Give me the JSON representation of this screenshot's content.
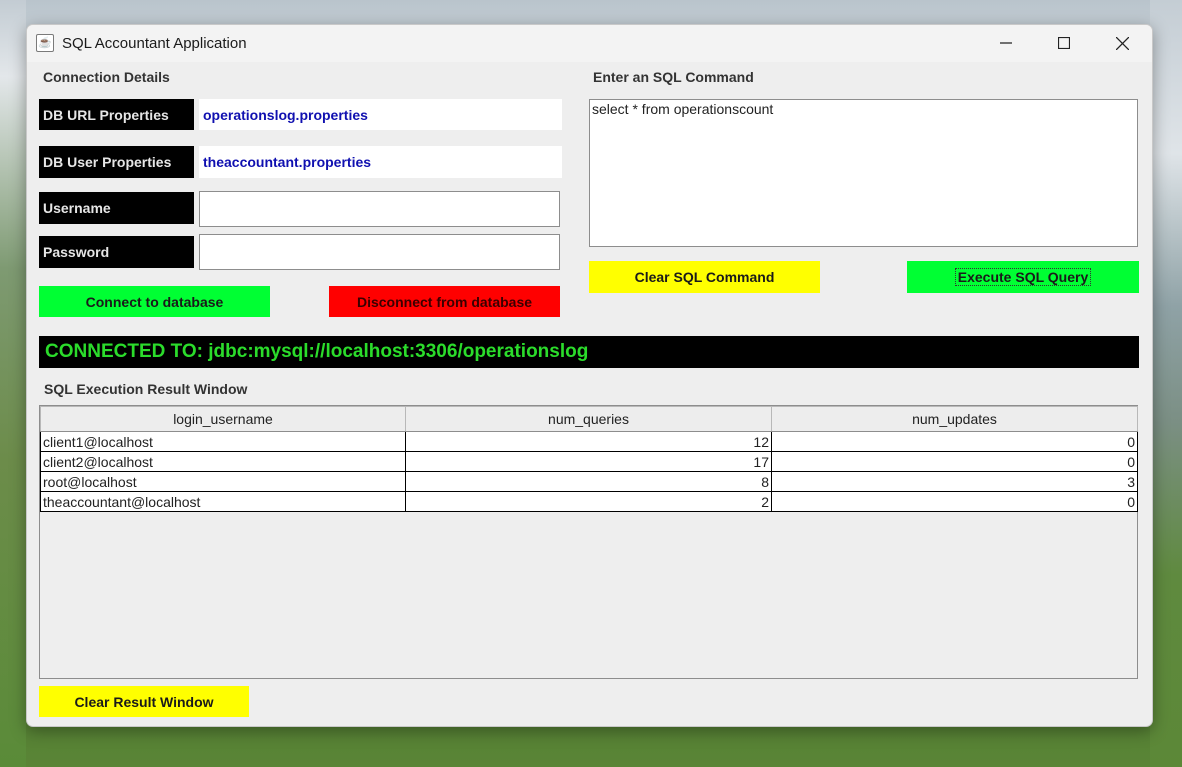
{
  "window": {
    "title": "SQL Accountant Application"
  },
  "connection": {
    "section_label": "Connection Details",
    "db_url_label": "DB URL Properties",
    "db_url_value": "operationslog.properties",
    "db_user_label": "DB User Properties",
    "db_user_value": "theaccountant.properties",
    "username_label": "Username",
    "username_value": "",
    "password_label": "Password",
    "password_value": "",
    "connect_button": "Connect to database",
    "disconnect_button": "Disconnect from database"
  },
  "sql": {
    "section_label": "Enter an SQL Command",
    "command_text": "select * from operationscount",
    "clear_button": "Clear SQL Command",
    "execute_button": "Execute SQL Query"
  },
  "status": {
    "text": "CONNECTED TO: jdbc:mysql://localhost:3306/operationslog"
  },
  "results": {
    "section_label": "SQL Execution Result Window",
    "columns": [
      "login_username",
      "num_queries",
      "num_updates"
    ],
    "rows": [
      [
        "client1@localhost",
        "12",
        "0"
      ],
      [
        "client2@localhost",
        "17",
        "0"
      ],
      [
        "root@localhost",
        "8",
        "3"
      ],
      [
        "theaccountant@localhost",
        "2",
        "0"
      ]
    ],
    "clear_button": "Clear Result Window"
  },
  "colors": {
    "connect_green": "#00ff33",
    "disconnect_red": "#ff0000",
    "clear_yellow": "#ffff00",
    "status_text_green": "#2bdc2b",
    "property_text_blue": "#1010b0"
  }
}
